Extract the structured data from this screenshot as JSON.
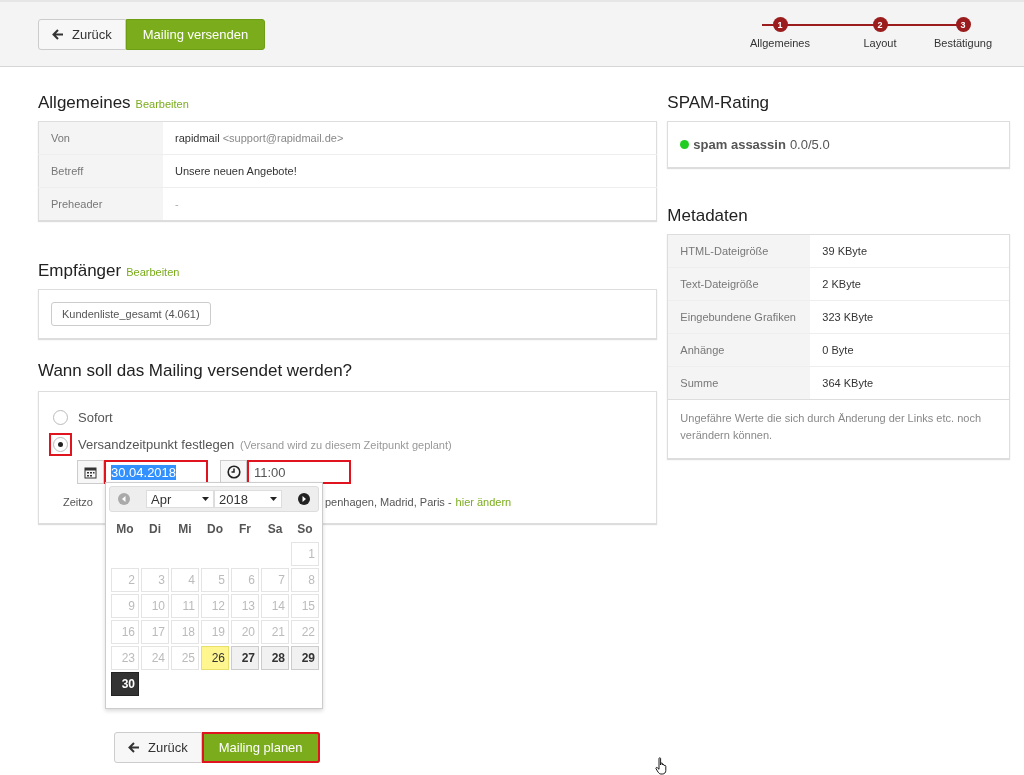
{
  "header": {
    "back_button": "Zurück",
    "primary_button": "Mailing versenden",
    "steps": [
      {
        "number": "1",
        "label": "Allgemeines"
      },
      {
        "number": "2",
        "label": "Layout"
      },
      {
        "number": "3",
        "label": "Bestätigung"
      }
    ]
  },
  "general": {
    "title": "Allgemeines",
    "edit_link": "Bearbeiten",
    "rows": [
      {
        "label": "Von",
        "value": "rapidmail",
        "detail": "<support@rapidmail.de>"
      },
      {
        "label": "Betreff",
        "value": "Unsere neuen Angebote!"
      },
      {
        "label": "Preheader",
        "value": "-",
        "muted": true
      }
    ]
  },
  "recipients": {
    "title": "Empfänger",
    "edit_link": "Bearbeiten",
    "lists": [
      "Kundenliste_gesamt (4.061)"
    ]
  },
  "schedule": {
    "title": "Wann soll das Mailing versendet werden?",
    "options": [
      {
        "label": "Sofort",
        "selected": false,
        "highlighted": false
      },
      {
        "label": "Versandzeitpunkt festlegen",
        "hint": "(Versand wird zu diesem Zeitpunkt geplant)",
        "selected": true,
        "highlighted": true
      }
    ],
    "date_field": {
      "value": "30.04.2018",
      "text_selected": true,
      "highlighted": true
    },
    "time_field": {
      "value": "11:00",
      "highlighted": true
    },
    "timezone_start": "Zeitzo",
    "timezone_end": "penhagen, Madrid, Paris -",
    "timezone_link": "hier ändern"
  },
  "calendar": {
    "month": "Apr",
    "year": "2018",
    "weekdays": [
      "Mo",
      "Di",
      "Mi",
      "Do",
      "Fr",
      "Sa",
      "So"
    ],
    "weeks": [
      [
        {
          "day": "1",
          "kind": "past",
          "selected": false
        }
      ],
      [
        {
          "day": "2",
          "kind": "past",
          "selected": false
        },
        {
          "day": "3",
          "kind": "past",
          "selected": false
        },
        {
          "day": "4",
          "kind": "past",
          "selected": false
        },
        {
          "day": "5",
          "kind": "past",
          "selected": false
        },
        {
          "day": "6",
          "kind": "past",
          "selected": false
        },
        {
          "day": "7",
          "kind": "past",
          "selected": false
        },
        {
          "day": "8",
          "kind": "past",
          "selected": false
        }
      ],
      [
        {
          "day": "9",
          "kind": "past",
          "selected": false
        },
        {
          "day": "10",
          "kind": "past",
          "selected": false
        },
        {
          "day": "11",
          "kind": "past",
          "selected": false
        },
        {
          "day": "12",
          "kind": "past",
          "selected": false
        },
        {
          "day": "13",
          "kind": "past",
          "selected": false
        },
        {
          "day": "14",
          "kind": "past",
          "selected": false
        },
        {
          "day": "15",
          "kind": "past",
          "selected": false
        }
      ],
      [
        {
          "day": "16",
          "kind": "past",
          "selected": false
        },
        {
          "day": "17",
          "kind": "past",
          "selected": false
        },
        {
          "day": "18",
          "kind": "past",
          "selected": false
        },
        {
          "day": "19",
          "kind": "past",
          "selected": false
        },
        {
          "day": "20",
          "kind": "past",
          "selected": false
        },
        {
          "day": "21",
          "kind": "past",
          "selected": false
        },
        {
          "day": "22",
          "kind": "past",
          "selected": false
        }
      ],
      [
        {
          "day": "23",
          "kind": "past",
          "selected": false
        },
        {
          "day": "24",
          "kind": "past",
          "selected": false
        },
        {
          "day": "25",
          "kind": "past",
          "selected": false
        },
        {
          "day": "26",
          "kind": "today",
          "selected": false
        },
        {
          "day": "27",
          "kind": "available",
          "selected": false
        },
        {
          "day": "28",
          "kind": "available",
          "selected": false
        },
        {
          "day": "29",
          "kind": "available",
          "selected": false
        }
      ],
      [
        {
          "day": "30",
          "kind": "available",
          "selected": true
        }
      ]
    ]
  },
  "footer": {
    "back_button": "Zurück",
    "primary_button": "Mailing planen",
    "primary_highlighted": true
  },
  "spam": {
    "title": "SPAM-Rating",
    "color": "#22cc22",
    "name": "spam assassin",
    "score": "0.0/5.0"
  },
  "metadata": {
    "title": "Metadaten",
    "rows": [
      {
        "label": "HTML-Dateigröße",
        "value": "39 KByte"
      },
      {
        "label": "Text-Dateigröße",
        "value": "2 KByte"
      },
      {
        "label": "Eingebundene Grafiken",
        "value": "323 KByte"
      },
      {
        "label": "Anhänge",
        "value": "0 Byte"
      },
      {
        "label": "Summe",
        "value": "364 KByte"
      }
    ],
    "note": "Ungefähre Werte die sich durch Änderung der Links etc. noch verändern können."
  }
}
